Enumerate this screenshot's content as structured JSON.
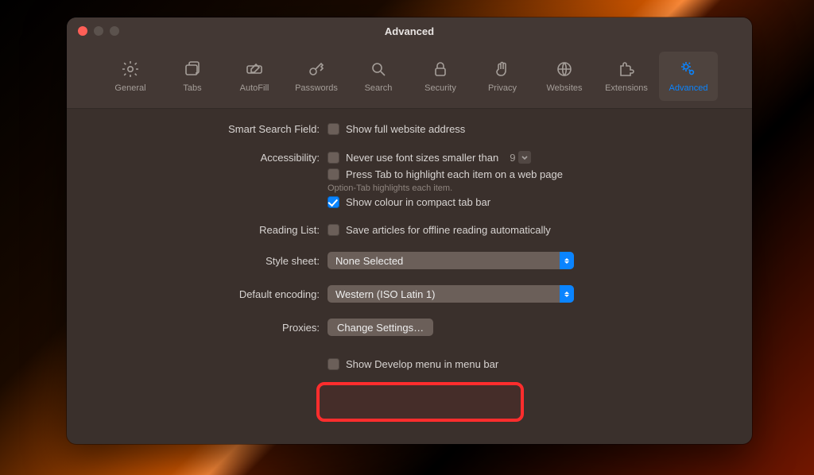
{
  "window": {
    "title": "Advanced"
  },
  "tabs": [
    {
      "id": "general",
      "label": "General"
    },
    {
      "id": "tabs",
      "label": "Tabs"
    },
    {
      "id": "autofill",
      "label": "AutoFill"
    },
    {
      "id": "passwords",
      "label": "Passwords"
    },
    {
      "id": "search",
      "label": "Search"
    },
    {
      "id": "security",
      "label": "Security"
    },
    {
      "id": "privacy",
      "label": "Privacy"
    },
    {
      "id": "websites",
      "label": "Websites"
    },
    {
      "id": "extensions",
      "label": "Extensions"
    },
    {
      "id": "advanced",
      "label": "Advanced",
      "active": true
    }
  ],
  "labels": {
    "smart_search": "Smart Search Field:",
    "accessibility": "Accessibility:",
    "reading_list": "Reading List:",
    "style_sheet": "Style sheet:",
    "default_encoding": "Default encoding:",
    "proxies": "Proxies:"
  },
  "options": {
    "show_full_address": "Show full website address",
    "min_font_size": "Never use font sizes smaller than",
    "min_font_value": "9",
    "press_tab": "Press Tab to highlight each item on a web page",
    "option_tab_hint": "Option-Tab highlights each item.",
    "compact_colour": "Show colour in compact tab bar",
    "save_offline": "Save articles for offline reading automatically",
    "style_value": "None Selected",
    "encoding_value": "Western (ISO Latin 1)",
    "proxies_button": "Change Settings…",
    "show_develop": "Show Develop menu in menu bar"
  },
  "help": "?"
}
